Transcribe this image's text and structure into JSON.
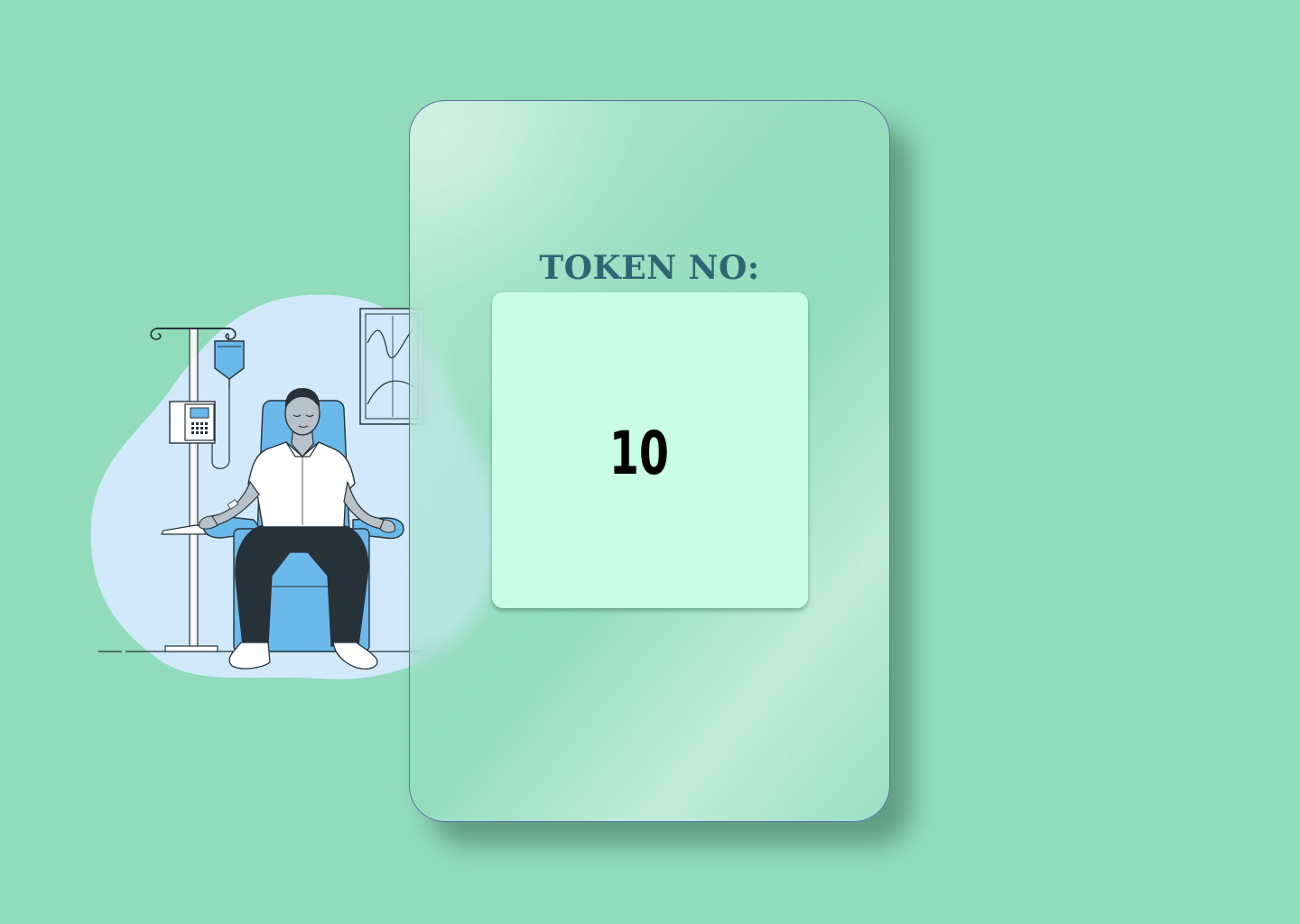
{
  "token": {
    "title": "TOKEN NO:",
    "number": "10"
  },
  "colors": {
    "background": "#90dcbb",
    "title": "#2f6673",
    "token_box": "#c9fde6",
    "number": "#000000"
  },
  "illustration": {
    "subject": "patient-in-infusion-chair"
  }
}
